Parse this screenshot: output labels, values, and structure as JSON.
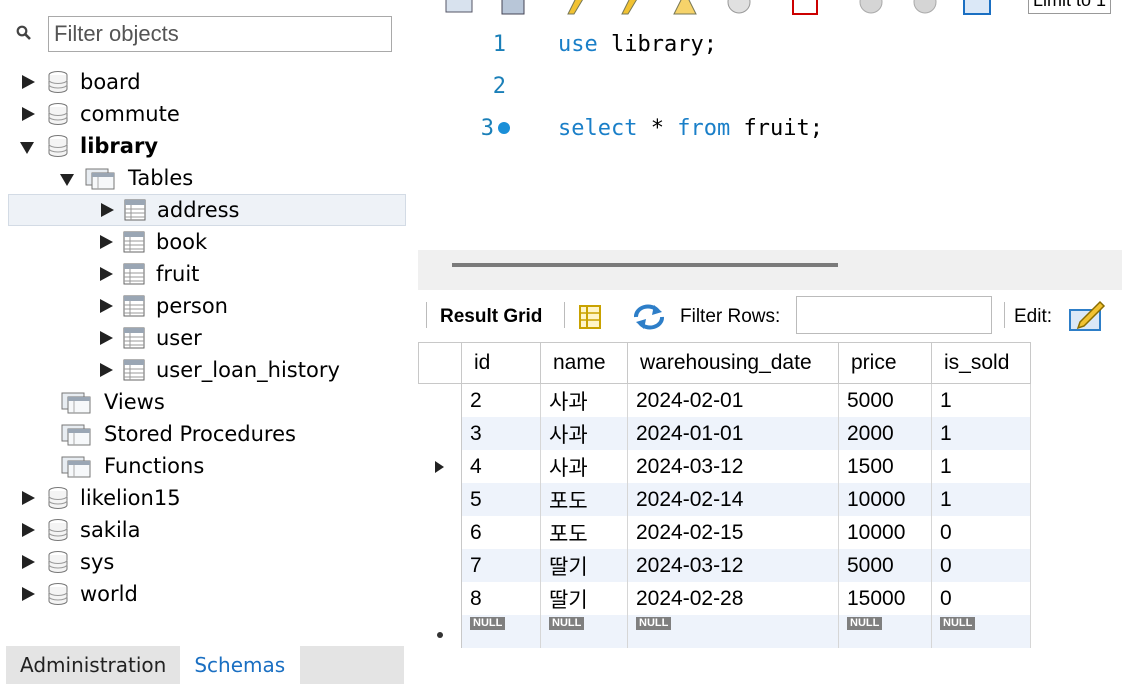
{
  "sidebar": {
    "filter_placeholder": "Filter objects",
    "tree": [
      {
        "label": "board",
        "level": 0,
        "expanded": false,
        "icon": "database-icon"
      },
      {
        "label": "commute",
        "level": 0,
        "expanded": false,
        "icon": "database-icon"
      },
      {
        "label": "library",
        "level": 0,
        "expanded": true,
        "bold": true,
        "icon": "database-icon"
      },
      {
        "label": "Tables",
        "level": 1,
        "expanded": true,
        "icon": "tables-folder-icon"
      },
      {
        "label": "address",
        "level": 2,
        "expanded": false,
        "selected": true,
        "icon": "table-icon"
      },
      {
        "label": "book",
        "level": 2,
        "expanded": false,
        "icon": "table-icon"
      },
      {
        "label": "fruit",
        "level": 2,
        "expanded": false,
        "icon": "table-icon"
      },
      {
        "label": "person",
        "level": 2,
        "expanded": false,
        "icon": "table-icon"
      },
      {
        "label": "user",
        "level": 2,
        "expanded": false,
        "icon": "table-icon"
      },
      {
        "label": "user_loan_history",
        "level": 2,
        "expanded": false,
        "icon": "table-icon"
      },
      {
        "label": "Views",
        "level": 1,
        "leaf": true,
        "icon": "views-folder-icon"
      },
      {
        "label": "Stored Procedures",
        "level": 1,
        "leaf": true,
        "icon": "procedures-folder-icon"
      },
      {
        "label": "Functions",
        "level": 1,
        "leaf": true,
        "icon": "functions-folder-icon"
      },
      {
        "label": "likelion15",
        "level": 0,
        "expanded": false,
        "icon": "database-icon"
      },
      {
        "label": "sakila",
        "level": 0,
        "expanded": false,
        "icon": "database-icon"
      },
      {
        "label": "sys",
        "level": 0,
        "expanded": false,
        "icon": "database-icon"
      },
      {
        "label": "world",
        "level": 0,
        "expanded": false,
        "icon": "database-icon"
      }
    ],
    "tabs": [
      {
        "label": "Administration",
        "active": false
      },
      {
        "label": "Schemas",
        "active": true
      }
    ]
  },
  "toolbar": {
    "limit_label": "Limit to 1"
  },
  "editor": {
    "lines": [
      {
        "number": "1",
        "keyword": "use",
        "rest": " library;"
      },
      {
        "number": "2",
        "keyword": "",
        "rest": ""
      },
      {
        "number": "3",
        "keyword": "select",
        "mid": " * ",
        "keyword2": "from",
        "rest": " fruit;",
        "breakpoint": true
      }
    ]
  },
  "result_toolbar": {
    "result_grid_label": "Result Grid",
    "filter_rows_label": "Filter Rows:",
    "edit_label": "Edit:"
  },
  "grid": {
    "columns": [
      "id",
      "name",
      "warehousing_date",
      "price",
      "is_sold"
    ],
    "rows": [
      [
        "2",
        "사과",
        "2024-02-01",
        "5000",
        "1"
      ],
      [
        "3",
        "사과",
        "2024-01-01",
        "2000",
        "1"
      ],
      [
        "4",
        "사과",
        "2024-03-12",
        "1500",
        "1"
      ],
      [
        "5",
        "포도",
        "2024-02-14",
        "10000",
        "1"
      ],
      [
        "6",
        "포도",
        "2024-02-15",
        "10000",
        "0"
      ],
      [
        "7",
        "딸기",
        "2024-03-12",
        "5000",
        "0"
      ],
      [
        "8",
        "딸기",
        "2024-02-28",
        "15000",
        "0"
      ]
    ],
    "current_row_index": 2,
    "null_label": "NULL"
  },
  "colors": {
    "keyword": "#1a7fc8",
    "active_tab": "#1a6fc2",
    "alt_row": "#eef3fb"
  }
}
